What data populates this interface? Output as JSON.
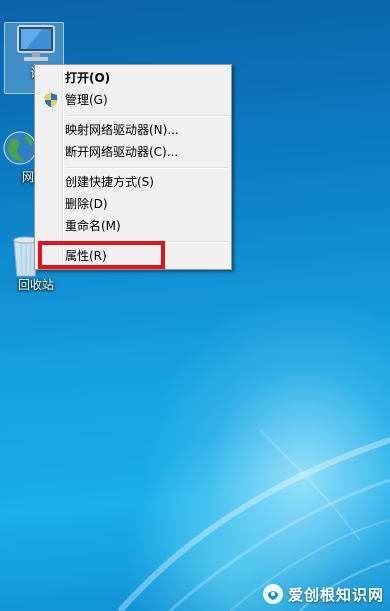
{
  "desktop": {
    "icons": {
      "computer": {
        "label": "计"
      },
      "network": {
        "label": "网"
      },
      "recycle_bin": {
        "label": "回收站"
      }
    }
  },
  "context_menu": {
    "items": [
      {
        "label": "打开(O)",
        "bold": true,
        "icon": ""
      },
      {
        "label": "管理(G)",
        "bold": false,
        "icon": "uac-shield-icon"
      },
      {
        "label": "映射网络驱动器(N)...",
        "bold": false,
        "icon": ""
      },
      {
        "label": "断开网络驱动器(C)...",
        "bold": false,
        "icon": ""
      },
      {
        "label": "创建快捷方式(S)",
        "bold": false,
        "icon": ""
      },
      {
        "label": "删除(D)",
        "bold": false,
        "icon": ""
      },
      {
        "label": "重命名(M)",
        "bold": false,
        "icon": ""
      },
      {
        "label": "属性(R)",
        "bold": false,
        "icon": ""
      }
    ],
    "highlighted_item": "属性(R)",
    "highlight_color": "#e0141a"
  },
  "watermark": {
    "text": "爱创根知识网"
  },
  "colors": {
    "desktop_top": "#0a63a8",
    "desktop_bottom": "#1aaeea",
    "menu_bg": "#f0f0f0"
  }
}
